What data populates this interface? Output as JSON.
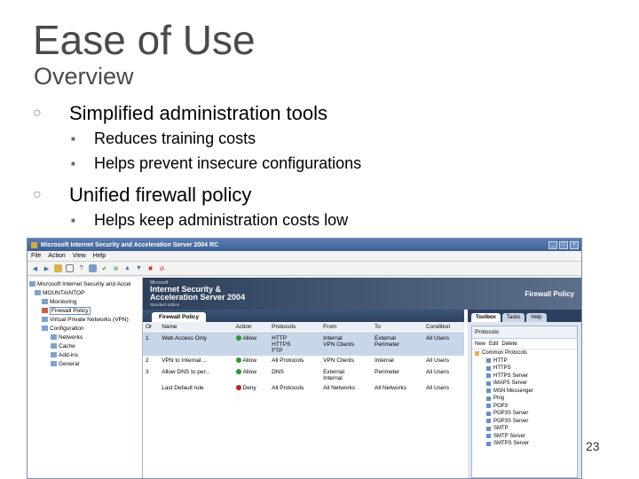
{
  "slide": {
    "title": "Ease of Use",
    "subtitle": "Overview",
    "bullets": [
      {
        "text": "Simplified administration tools",
        "sub": [
          "Reduces training costs",
          "Helps prevent insecure configurations"
        ]
      },
      {
        "text": "Unified firewall policy",
        "sub": [
          "Helps keep administration costs low"
        ]
      }
    ],
    "page_number": "23"
  },
  "app": {
    "window_title": "Microsoft Internet Security and Acceleration Server 2004 RC",
    "menu": [
      "File",
      "Action",
      "View",
      "Help"
    ],
    "tree": [
      "Microsoft Internet Security and Accel",
      "MOUNTAINTOP",
      "Monitoring",
      "Firewall Policy",
      "Virtual Private Networks (VPN)",
      "Configuration",
      "Networks",
      "Cache",
      "Add-ins",
      "General"
    ],
    "banner": {
      "ms": "Microsoft",
      "product_line1": "Internet Security &",
      "product_line2": "Acceleration Server 2004",
      "edition": "Standard Edition",
      "section": "Firewall Policy"
    },
    "policy_tab": "Firewall Policy",
    "columns": [
      "Or",
      "Name",
      "Action",
      "Protocols",
      "From",
      "To",
      "Condition"
    ],
    "rules": [
      {
        "order": "1",
        "name": "Web Access Only",
        "action": "Allow",
        "protocols": [
          "HTTP",
          "HTTPS",
          "FTP"
        ],
        "from": [
          "Internal",
          "VPN Clients"
        ],
        "to": [
          "External",
          "Perimeter"
        ],
        "condition": "All Users"
      },
      {
        "order": "2",
        "name": "VPN to Internal ...",
        "action": "Allow",
        "protocols": [
          "All Protocols"
        ],
        "from": [
          "VPN Clients"
        ],
        "to": [
          "Internal"
        ],
        "condition": "All Users"
      },
      {
        "order": "3",
        "name": "Allow DNS to per...",
        "action": "Allow",
        "protocols": [
          "DNS"
        ],
        "from": [
          "External",
          "Internal"
        ],
        "to": [
          "Perimeter"
        ],
        "condition": "All Users"
      },
      {
        "order": "",
        "name": "Last Default rule",
        "action": "Deny",
        "protocols": [
          "All Protocols"
        ],
        "from": [
          "All Networks"
        ],
        "to": [
          "All Networks"
        ],
        "condition": "All Users"
      }
    ],
    "task_tabs": [
      "Toolbox",
      "Tasks",
      "Help"
    ],
    "toolbox": {
      "section": "Protocols",
      "bar": [
        "New",
        "Edit",
        "Delete"
      ],
      "group": "Common Protocols",
      "items": [
        "HTTP",
        "HTTPS",
        "HTTPS Server",
        "IMAPS Server",
        "MSN Messenger",
        "Ping",
        "POP3",
        "POP3S Server",
        "POP3S Server",
        "SMTP",
        "SMTP Server",
        "SMTPS Server"
      ]
    },
    "colors": {
      "allow": "#2e9a2e",
      "deny": "#c02020",
      "accent": "#3d5f94"
    }
  }
}
